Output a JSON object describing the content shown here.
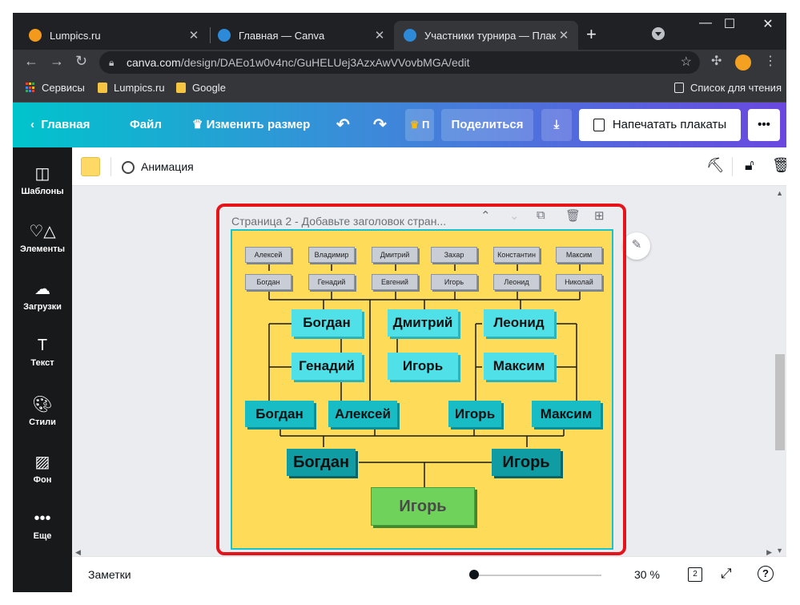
{
  "browser": {
    "tabs": [
      {
        "title": "Lumpics.ru",
        "active": false
      },
      {
        "title": "Главная — Canva",
        "active": false
      },
      {
        "title": "Участники турнира — Плакат",
        "active": true
      }
    ],
    "url_host": "canva.com",
    "url_path": "/design/DAEo1w0v4nc/GuHELUej3AzxAwVVovbMGA/edit",
    "bookmarks": [
      "Сервисы",
      "Lumpics.ru",
      "Google"
    ],
    "reading_list": "Список для чтения"
  },
  "canva_header": {
    "back": "Главная",
    "file": "Файл",
    "resize": "Изменить размер",
    "premium_hint": "П",
    "share": "Поделиться",
    "print": "Напечатать плакаты",
    "more": "•••"
  },
  "sidebar": {
    "items": [
      {
        "label": "Шаблоны",
        "icon": "templates-icon"
      },
      {
        "label": "Элементы",
        "icon": "elements-icon"
      },
      {
        "label": "Загрузки",
        "icon": "uploads-icon"
      },
      {
        "label": "Текст",
        "icon": "text-icon"
      },
      {
        "label": "Стили",
        "icon": "styles-icon"
      },
      {
        "label": "Фон",
        "icon": "background-icon"
      },
      {
        "label": "Еще",
        "icon": "more-icon"
      }
    ]
  },
  "context_bar": {
    "animation": "Анимация",
    "color": "#ffd966"
  },
  "page": {
    "header": "Страница 2 - Добавьте заголовок стран...",
    "background_color": "#ffdb5a",
    "border_color": "#19c3cc"
  },
  "bracket": {
    "round1_top": [
      "Алексей",
      "Владимир",
      "Дмитрий",
      "Захар",
      "Константин",
      "Максим"
    ],
    "round1_bottom": [
      "Богдан",
      "Генадий",
      "Евгений",
      "Игорь",
      "Леонид",
      "Николай"
    ],
    "round2_row1": [
      "Богдан",
      "Дмитрий",
      "Леонид"
    ],
    "round2_row2": [
      "Генадий",
      "Игорь",
      "Максим"
    ],
    "round3": [
      "Богдан",
      "Алексей",
      "Игорь",
      "Максим"
    ],
    "semifinal": [
      "Богдан",
      "Игорь"
    ],
    "winner": "Игорь"
  },
  "bottom_bar": {
    "notes": "Заметки",
    "zoom": "30 %",
    "pages": "2"
  },
  "colors": {
    "highlight": "#e5141a",
    "canva_gradient_start": "#00c4cc",
    "canva_gradient_end": "#6a48e0"
  }
}
